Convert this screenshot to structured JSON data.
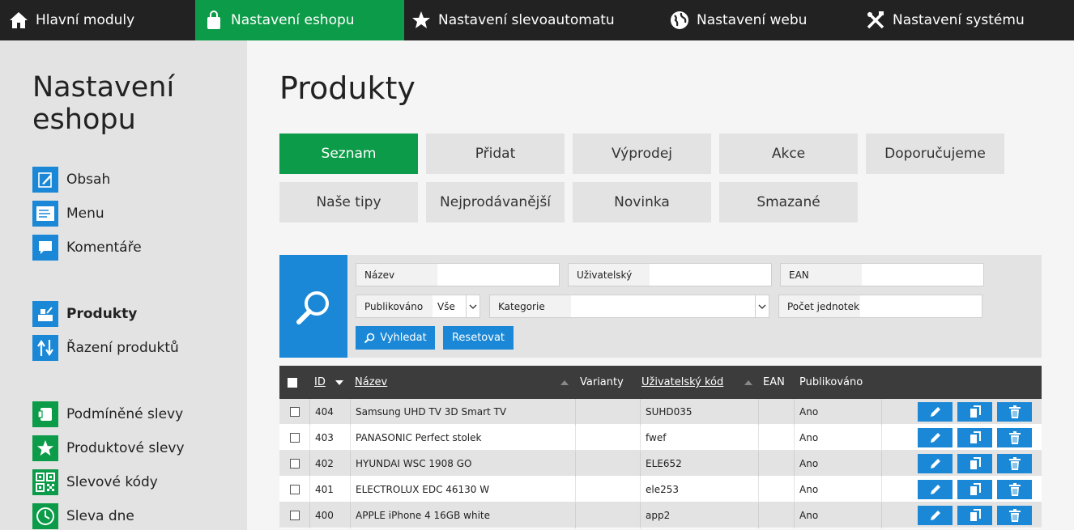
{
  "topnav": {
    "tabs": [
      {
        "label": "Hlavní moduly",
        "icon": "home-icon"
      },
      {
        "label": "Nastavení eshopu",
        "icon": "shopping-bag-icon",
        "active": true
      },
      {
        "label": "Nastavení slevoautomatu",
        "icon": "star-icon"
      },
      {
        "label": "Nastavení webu",
        "icon": "globe-icon"
      },
      {
        "label": "Nastavení systému",
        "icon": "tools-icon"
      }
    ]
  },
  "sidebar": {
    "title": "Nastavení eshopu",
    "items": [
      {
        "label": "Obsah",
        "icon": "edit-doc-icon"
      },
      {
        "label": "Menu",
        "icon": "menu-doc-icon"
      },
      {
        "label": "Komentáře",
        "icon": "comment-icon"
      },
      {
        "label": "Produkty",
        "icon": "products-icon"
      },
      {
        "label": "Řazení produktů",
        "icon": "sort-arrows-icon"
      },
      {
        "label": "Podmíněné slevy",
        "icon": "coupon-icon"
      },
      {
        "label": "Produktové slevy",
        "icon": "star-icon"
      },
      {
        "label": "Slevové kódy",
        "icon": "qr-code-icon"
      },
      {
        "label": "Sleva dne",
        "icon": "clock-icon"
      }
    ]
  },
  "main": {
    "title": "Produkty",
    "subtabs": [
      "Seznam",
      "Přidat",
      "Výprodej",
      "Akce",
      "Doporučujeme",
      "Naše tipy",
      "Nejprodávanější",
      "Novinka",
      "Smazané"
    ]
  },
  "search": {
    "name_label": "Název",
    "user_label": "Uživatelský",
    "ean_label": "EAN",
    "published_label": "Publikováno",
    "published_value": "Vše",
    "category_label": "Kategorie",
    "units_label": "Počet jednotek",
    "search_button": "Vyhledat",
    "reset_button": "Resetovat"
  },
  "table": {
    "headers": {
      "id": "ID",
      "name": "Název",
      "variants": "Varianty",
      "user_code": "Uživatelský kód",
      "ean": "EAN",
      "published": "Publikováno"
    },
    "rows": [
      {
        "id": "404",
        "name": "Samsung UHD TV 3D Smart TV",
        "variants": "",
        "code": "SUHD035",
        "ean": "",
        "published": "Ano"
      },
      {
        "id": "403",
        "name": "PANASONIC Perfect stolek",
        "variants": "",
        "code": "fwef",
        "ean": "",
        "published": "Ano"
      },
      {
        "id": "402",
        "name": "HYUNDAI WSC 1908 GO",
        "variants": "",
        "code": "ELE652",
        "ean": "",
        "published": "Ano"
      },
      {
        "id": "401",
        "name": "ELECTROLUX EDC 46130 W",
        "variants": "",
        "code": "ele253",
        "ean": "",
        "published": "Ano"
      },
      {
        "id": "400",
        "name": "APPLE iPhone 4 16GB white",
        "variants": "",
        "code": "app2",
        "ean": "",
        "published": "Ano"
      }
    ]
  },
  "colors": {
    "green": "#0c9b48",
    "blue": "#1a88d6",
    "dark": "#222222"
  }
}
